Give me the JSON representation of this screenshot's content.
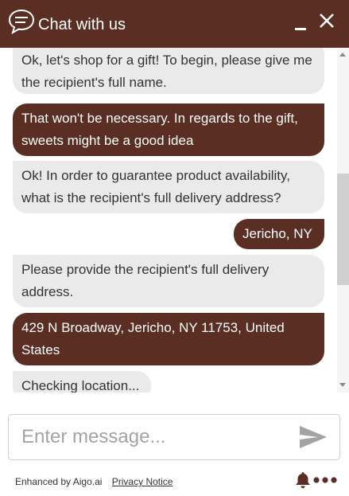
{
  "header": {
    "title": "Chat with us"
  },
  "messages": [
    {
      "sender": "bot",
      "text": "Ok, let's shop for a gift! To begin, please give me the recipient's full name."
    },
    {
      "sender": "user",
      "text": "That won't be necessary. In regards to the gift, sweets might be a good idea"
    },
    {
      "sender": "bot",
      "text": "Ok! In order to guarantee product availability, what is the recipient's full delivery address?"
    },
    {
      "sender": "user",
      "text": "Jericho, NY"
    },
    {
      "sender": "bot",
      "text": "Please provide the recipient's full delivery address."
    },
    {
      "sender": "user",
      "text": "429 N Broadway, Jericho, NY 11753, United States"
    },
    {
      "sender": "bot",
      "text": "Checking location..."
    }
  ],
  "input": {
    "placeholder": "Enter message..."
  },
  "footer": {
    "enhanced_by": "Enhanced by Aigo.ai",
    "privacy_link": "Privacy Notice"
  },
  "colors": {
    "brand": "#5a2e22",
    "bot_bubble": "#eaeaea",
    "bot_text": "#333333",
    "user_text": "#ffffff"
  },
  "icons": {
    "chat": "speech-bubble-icon",
    "minimize": "minimize-icon",
    "close": "close-icon",
    "send": "send-icon",
    "bell": "bell-icon",
    "more": "more-dots-icon"
  }
}
